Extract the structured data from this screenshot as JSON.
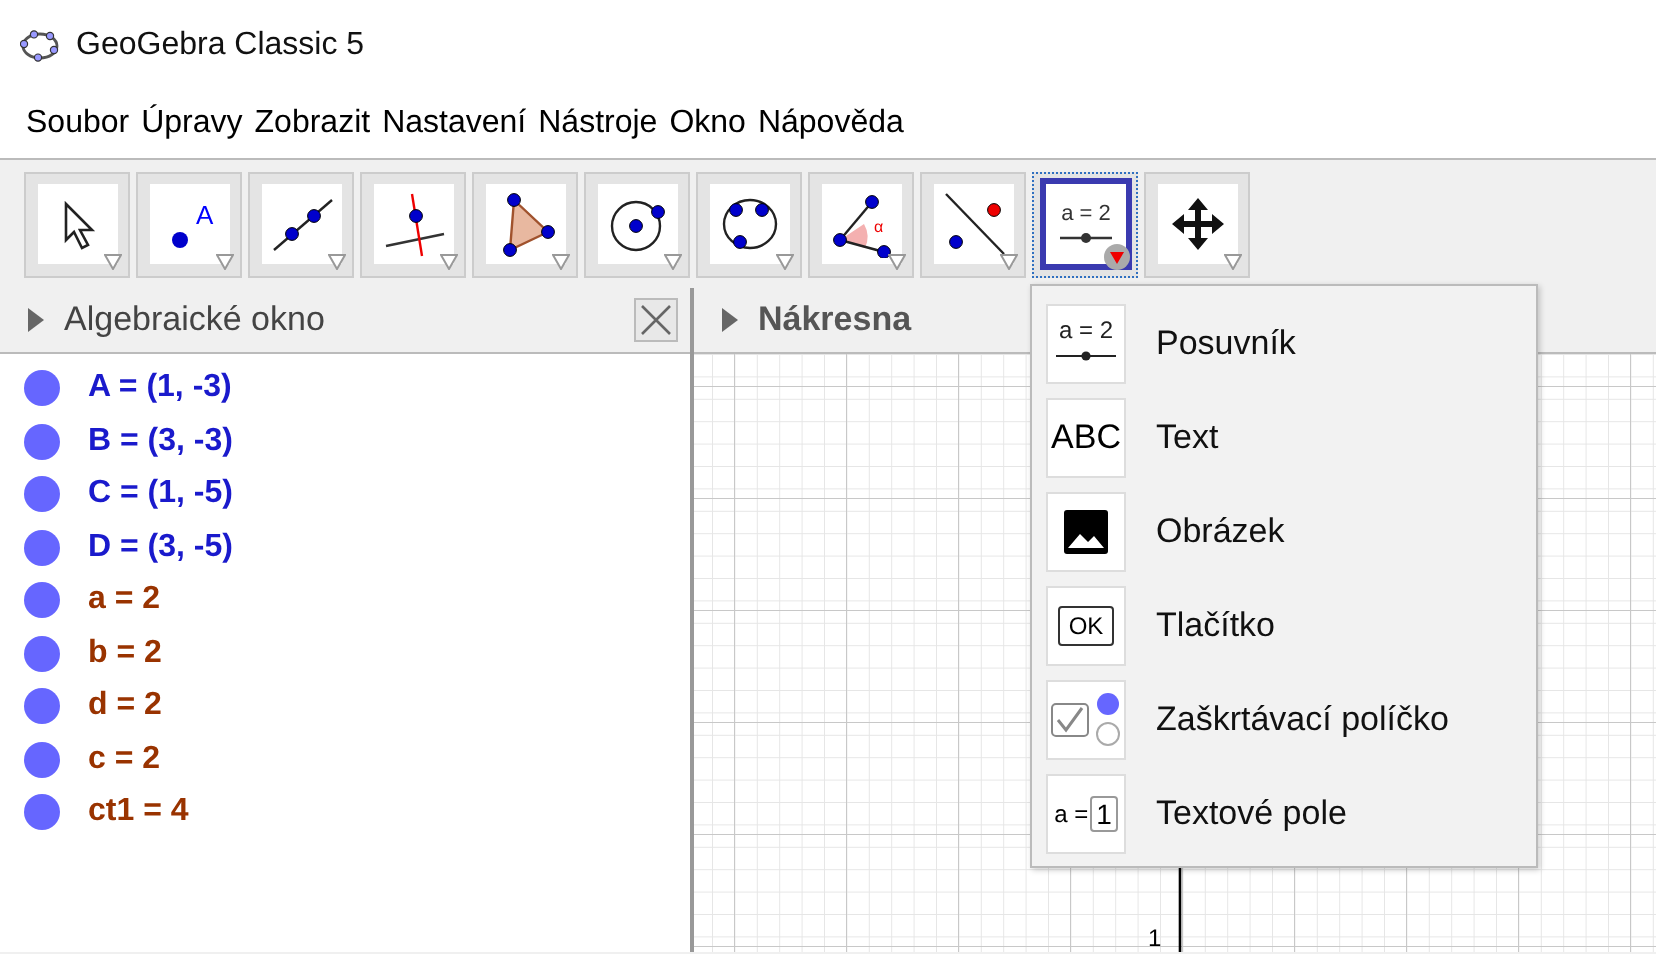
{
  "window": {
    "title": "GeoGebra Classic 5"
  },
  "menu": [
    "Soubor",
    "Úpravy",
    "Zobrazit",
    "Nastavení",
    "Nástroje",
    "Okno",
    "Nápověda"
  ],
  "toolbar": [
    {
      "kind": "pointer",
      "selected": false
    },
    {
      "kind": "point",
      "glyph": "A",
      "selected": false
    },
    {
      "kind": "line",
      "selected": false
    },
    {
      "kind": "perpendicular",
      "selected": false
    },
    {
      "kind": "polygon",
      "selected": false
    },
    {
      "kind": "circle",
      "selected": false
    },
    {
      "kind": "circle3",
      "selected": false
    },
    {
      "kind": "angle",
      "glyph": "α",
      "selected": false
    },
    {
      "kind": "reflect",
      "selected": false
    },
    {
      "kind": "slider",
      "glyph": "a = 2",
      "selected": true
    },
    {
      "kind": "move",
      "selected": false
    }
  ],
  "algebra": {
    "title": "Algebraické okno",
    "items": [
      {
        "text": "A = (1, -3)",
        "color": "#1a1acc"
      },
      {
        "text": "B = (3, -3)",
        "color": "#1a1acc"
      },
      {
        "text": "C = (1, -5)",
        "color": "#1a1acc"
      },
      {
        "text": "D = (3, -5)",
        "color": "#1a1acc"
      },
      {
        "text": "a = 2",
        "color": "#993300"
      },
      {
        "text": "b = 2",
        "color": "#993300"
      },
      {
        "text": "d = 2",
        "color": "#993300"
      },
      {
        "text": "c = 2",
        "color": "#993300"
      },
      {
        "text": "ct1 = 4",
        "color": "#993300"
      }
    ]
  },
  "graphics": {
    "title": "Nákresna",
    "tick_label": "1"
  },
  "dropdown": [
    {
      "kind": "slider",
      "glyph": "a = 2",
      "label": "Posuvník"
    },
    {
      "kind": "text",
      "glyph": "ABC",
      "label": "Text"
    },
    {
      "kind": "image",
      "label": "Obrázek"
    },
    {
      "kind": "button",
      "glyph": "OK",
      "label": "Tlačítko"
    },
    {
      "kind": "checkbox",
      "label": "Zaškrtávací políčko"
    },
    {
      "kind": "input",
      "glyph": "a =",
      "field": "1",
      "label": "Textové pole"
    }
  ]
}
